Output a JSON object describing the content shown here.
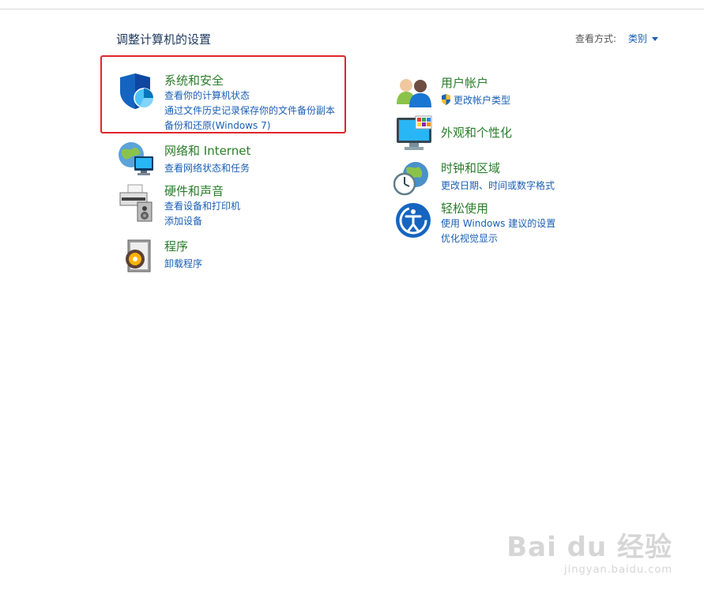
{
  "header": {
    "title": "调整计算机的设置",
    "view_by_label": "查看方式:",
    "view_by_value": "类别"
  },
  "categories": {
    "system_security": {
      "title": "系统和安全",
      "links": [
        "查看你的计算机状态",
        "通过文件历史记录保存你的文件备份副本",
        "备份和还原(Windows 7)"
      ]
    },
    "network": {
      "title": "网络和 Internet",
      "links": [
        "查看网络状态和任务"
      ]
    },
    "hardware": {
      "title": "硬件和声音",
      "links": [
        "查看设备和打印机",
        "添加设备"
      ]
    },
    "programs": {
      "title": "程序",
      "links": [
        "卸载程序"
      ]
    },
    "user_accounts": {
      "title": "用户帐户",
      "links": [
        "更改帐户类型"
      ]
    },
    "appearance": {
      "title": "外观和个性化",
      "links": []
    },
    "clock_region": {
      "title": "时钟和区域",
      "links": [
        "更改日期、时间或数字格式"
      ]
    },
    "ease_of_access": {
      "title": "轻松使用",
      "links": [
        "使用 Windows 建议的设置",
        "优化视觉显示"
      ]
    }
  },
  "watermark": {
    "main": "Bai du 经验",
    "sub": "jingyan.baidu.com"
  },
  "colors": {
    "category_title": "#2a7d2a",
    "link": "#1a5fb4",
    "highlight_border": "#e0262b"
  }
}
